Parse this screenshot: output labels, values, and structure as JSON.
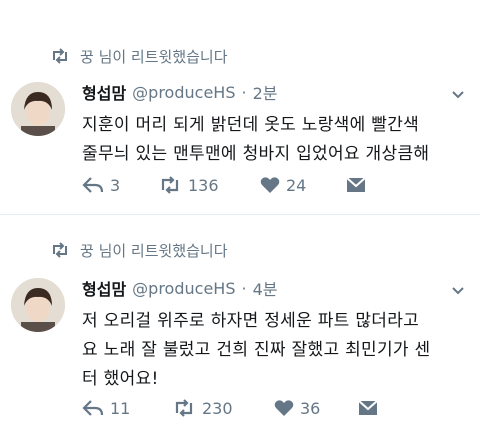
{
  "tweets": [
    {
      "retweet_label": "꿍 님이 리트윗했습니다",
      "name": "형섭맘",
      "handle": "@produceHS",
      "sep": "·",
      "time": "2분",
      "lines": [
        "지훈이 머리 되게 밝던데 옷도 노랑색에 빨간색",
        "줄무늬 있는 맨투맨에 청바지 입었어요 개상큼해"
      ],
      "replies": "3",
      "retweets": "136",
      "likes": "24"
    },
    {
      "retweet_label": "꿍 님이 리트윗했습니다",
      "name": "형섭맘",
      "handle": "@produceHS",
      "sep": "·",
      "time": "4분",
      "lines": [
        "저 오리걸 위주로 하자면 정세운 파트 많더라고",
        "요 노래 잘 불렀고 건희 진짜 잘했고 최민기가 센",
        "터 했어요!"
      ],
      "replies": "11",
      "retweets": "230",
      "likes": "36"
    }
  ],
  "icons": {
    "retweet": "retweet-icon",
    "reply": "reply-icon",
    "like": "heart-icon",
    "dm": "envelope-icon",
    "more": "chevron-down-icon"
  },
  "colors": {
    "secondary": "#657786",
    "text": "#14171a",
    "divider": "#e6ecf0"
  }
}
